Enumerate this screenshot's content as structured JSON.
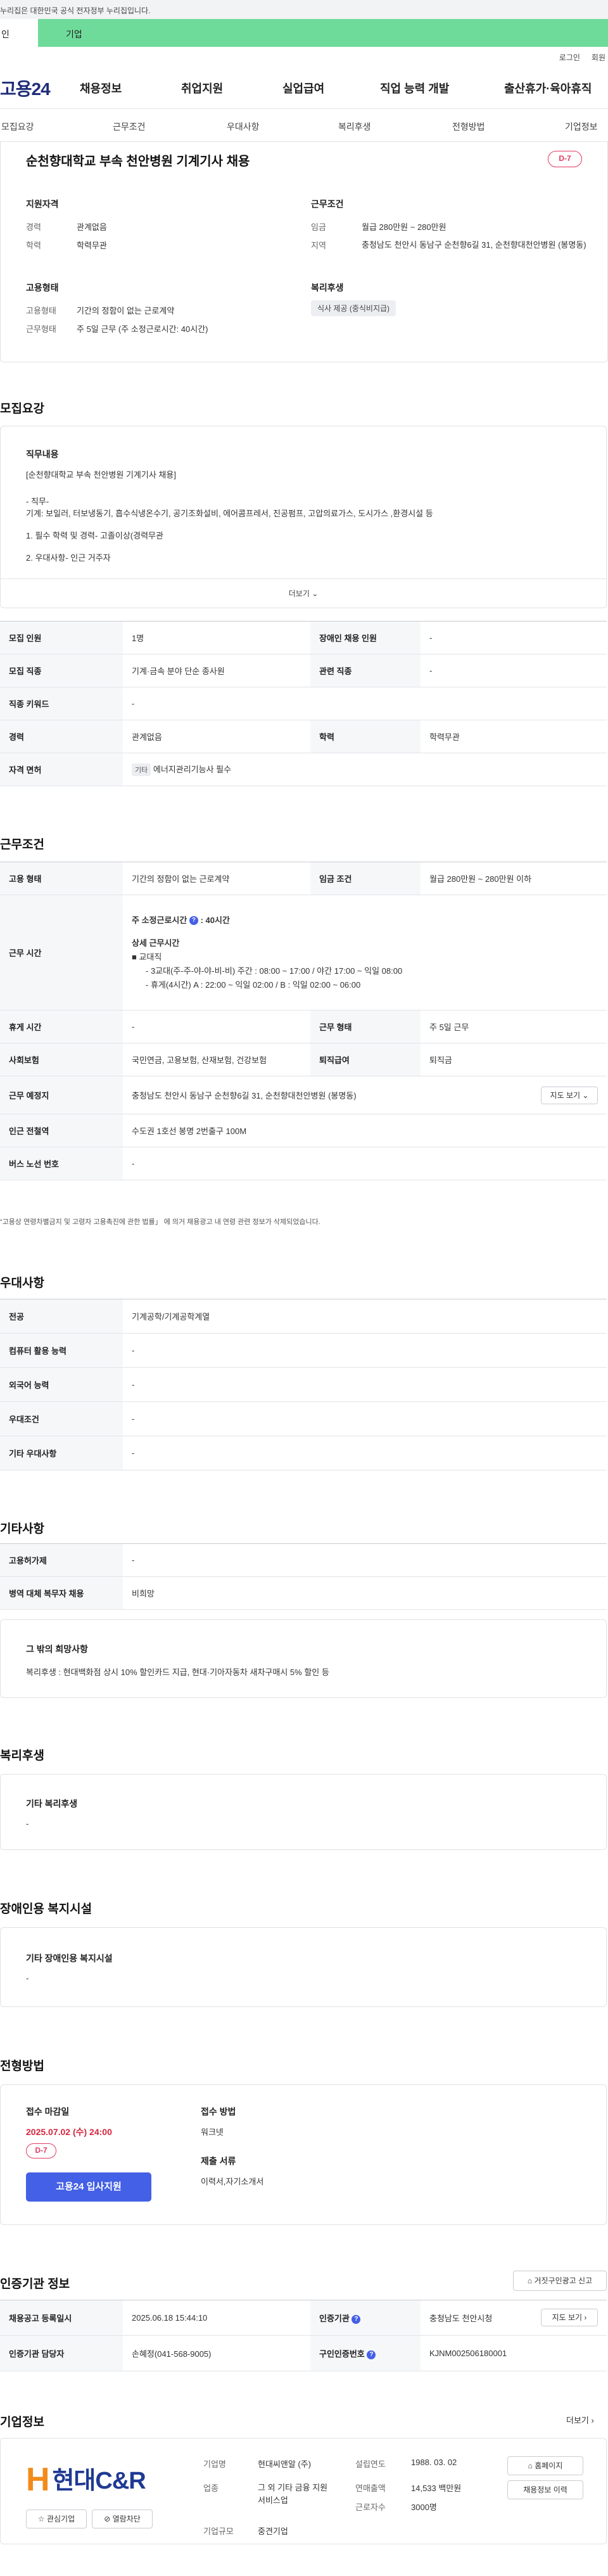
{
  "banner": {
    "text": "누리집은 대한민국 공식 전자정부 누리집입니다."
  },
  "user_tabs": {
    "person": "인",
    "business": "기업"
  },
  "util": {
    "login": "로그인",
    "signup": "회원"
  },
  "gnb": {
    "logo": "고용24",
    "items": [
      "채용정보",
      "취업지원",
      "실업급여",
      "직업 능력 개발",
      "출산휴가·육아휴직"
    ]
  },
  "subnav": {
    "items": [
      "모집요강",
      "근무조건",
      "우대사항",
      "복리후생",
      "전형방법",
      "기업정보"
    ]
  },
  "summary": {
    "title": "순천향대학교 부속 천안병원 기계기사 채용",
    "dday": "D-7",
    "qualification": {
      "heading": "지원자격",
      "rows": [
        {
          "label": "경력",
          "value": "관계없음"
        },
        {
          "label": "학력",
          "value": "학력무관"
        }
      ]
    },
    "conditions": {
      "heading": "근무조건",
      "rows": [
        {
          "label": "임금",
          "value": "월급 280만원 ~ 280만원"
        },
        {
          "label": "지역",
          "value": "충청남도 천안시 동남구 순천향6길 31, 순천향대천안병원 (봉명동)"
        }
      ]
    },
    "employment": {
      "heading": "고용형태",
      "rows": [
        {
          "label": "고용형태",
          "value": "기간의 정함이 없는 근로계약"
        },
        {
          "label": "근무형태",
          "value": "주 5일 근무 (주 소정근로시간: 40시간)"
        }
      ]
    },
    "welfare": {
      "heading": "복리후생",
      "tag": "식사 제공 (중식비지급)"
    }
  },
  "recruit": {
    "section_title": "모집요강",
    "duty_heading": "직무내용",
    "duty_lines": [
      "[순천향대학교 부속 천안병원 기계기사 채용]",
      "- 직무-",
      "기계: 보일러, 터보냉동기, 흡수식냉온수기, 공기조화설비, 에어콤프레서, 진공펌프, 고압의료가스, 도시가스 ,환경시설 등",
      "1. 필수 학력 및 경력- 고졸이상(경력무관",
      "2. 우대사항- 인근 거주자"
    ],
    "more": "더보기",
    "table": [
      [
        {
          "th": "모집 인원"
        },
        {
          "td": "1명"
        },
        {
          "th": "장애인 채용 인원"
        },
        {
          "td": "-"
        }
      ],
      [
        {
          "th": "모집 직종"
        },
        {
          "td": "기계·금속 분야 단순 종사원"
        },
        {
          "th": "관련 직종"
        },
        {
          "td": "-"
        }
      ],
      [
        {
          "th": "직종 키워드"
        },
        {
          "td": "-"
        }
      ],
      [
        {
          "th": "경력"
        },
        {
          "td": "관계없음"
        },
        {
          "th": "학력"
        },
        {
          "td": "학력무관"
        }
      ],
      [
        {
          "th": "자격 면허"
        },
        {
          "tag": "기타",
          "td": "에너지관리기능사 필수"
        }
      ]
    ]
  },
  "work": {
    "section_title": "근무조건",
    "employment_type_label": "고용 형태",
    "employment_type": "기간의 정함이 없는 근로계약",
    "wage_label": "임금 조건",
    "wage": "월급 280만원 ~ 280만원 이하",
    "hours_label": "근무 시간",
    "hours_main_prefix": "주 소정근로시간",
    "hours_main_value": ": 40시간",
    "hours_detail_heading": "상세 근무시간",
    "hours_detail": [
      "■ 교대직",
      "- 3교대(주-주-야-야-비-비) 주간 : 08:00 ~ 17:00 / 야간 17:00 ~ 익일 08:00",
      "- 휴게(4시간) A : 22:00 ~ 익일 02:00 / B : 익일 02:00 ~ 06:00"
    ],
    "rows": [
      {
        "l1": "휴게 시간",
        "v1": "-",
        "l2": "근무 형태",
        "v2": "주 5일 근무"
      },
      {
        "l1": "사회보험",
        "v1": "국민연금, 고용보험, 산재보험, 건강보험",
        "l2": "퇴직급여",
        "v2": "퇴직금"
      }
    ],
    "location_label": "근무 예정지",
    "location": "충청남도 천안시 동남구 순천향6길 31, 순천향대천안병원 (봉명동)",
    "map_btn": "지도 보기",
    "station_label": "인근 전철역",
    "station": "수도권 1호선 봉명 2번출구 100M",
    "bus_label": "버스 노선 번호",
    "bus": "-",
    "notice": "“고용상 연령차별금지 및 고령자 고용촉진에 관한 법률」 에 의거 채용광고 내 연령 관련 정보가 삭제되었습니다."
  },
  "preference": {
    "section_title": "우대사항",
    "rows": [
      {
        "label": "전공",
        "value": "기계공학/기계공학계열"
      },
      {
        "label": "컴퓨터 활용 능력",
        "value": "-"
      },
      {
        "label": "외국어 능력",
        "value": "-"
      },
      {
        "label": "우대조건",
        "value": "-"
      },
      {
        "label": "기타 우대사항",
        "value": "-"
      }
    ]
  },
  "etc": {
    "section_title": "기타사항",
    "rows": [
      {
        "label": "고용허가제",
        "value": "-"
      },
      {
        "label": "병역 대체 복무자 채용",
        "value": "비희망"
      }
    ],
    "box_heading": "그 밖의 희망사항",
    "box_text": "복리후생 : 현대백화점 상시 10% 할인카드 지급, 현대·기아자동차 새차구매시 5% 할인 등"
  },
  "benefit": {
    "section_title": "복리후생",
    "heading": "기타 복리후생",
    "value": "-"
  },
  "disabled": {
    "section_title": "장애인용 복지시설",
    "heading": "기타 장애인용 복지시설",
    "value": "-"
  },
  "screening": {
    "section_title": "전형방법",
    "deadline_label": "접수 마감일",
    "deadline": "2025.07.02 (수) 24:00",
    "dday": "D-7",
    "apply_btn": "고용24 입사지원",
    "method_label": "접수 방법",
    "method": "워크넷",
    "docs_label": "제출 서류",
    "docs": "이력서,자기소개서"
  },
  "cert": {
    "section_title": "인증기관 정보",
    "report_btn": "거짓구인광고 신고",
    "r1_l1": "채용공고 등록일시",
    "r1_v1": "2025.06.18 15:44:10",
    "r1_l2": "인증기관",
    "r1_v2": "충청남도 천안시청",
    "map_btn": "지도 보기",
    "r2_l1": "인증기관 담당자",
    "r2_v1": "손혜정(041-568-9005)",
    "r2_l2": "구인인증번호",
    "r2_v2": "KJNM002506180001"
  },
  "company": {
    "section_title": "기업정보",
    "more": "더보기",
    "logo_h": "H",
    "logo_text": "현대C&R",
    "fav_btn": "관심기업",
    "block_btn": "열람차단",
    "name_label": "기업명",
    "name": "현대씨앤알 (주)",
    "industry_label": "업종",
    "industry": "그 외 기타 금융 지원 서비스업",
    "size_label": "기업규모",
    "size": "중견기업",
    "founded_label": "설립연도",
    "founded": "1988. 03. 02",
    "sales_label": "연매출액",
    "sales": "14,533 백만원",
    "staff_label": "근로자수",
    "staff": "3000명",
    "homepage_btn": "홈페이지",
    "jobs_btn": "채용정보 이력"
  }
}
